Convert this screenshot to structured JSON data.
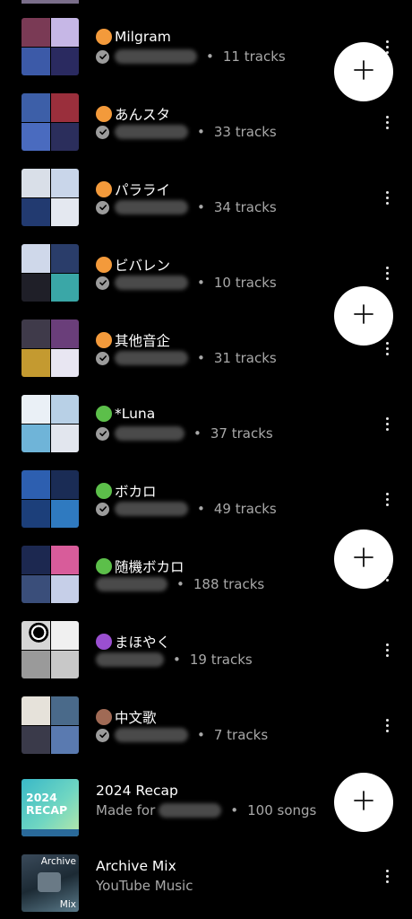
{
  "playlists": [
    {
      "title": "Milgram",
      "dot_color": "#f39a3b",
      "verified": true,
      "redact_w": 92,
      "count": "11 tracks",
      "thumb": [
        "#7a3a55",
        "#c6b7e6",
        "#3c5aa8",
        "#2a2a60"
      ]
    },
    {
      "title": "あんスタ",
      "dot_color": "#f39a3b",
      "verified": true,
      "redact_w": 82,
      "count": "33 tracks",
      "thumb": [
        "#3d5fa8",
        "#9a2f3c",
        "#4a6bbf",
        "#2b2e5c"
      ]
    },
    {
      "title": "パラライ",
      "dot_color": "#f39a3b",
      "verified": true,
      "redact_w": 82,
      "count": "34 tracks",
      "thumb": [
        "#d9dfe8",
        "#c9d6ea",
        "#223a70",
        "#e4e8f0"
      ]
    },
    {
      "title": "ビバレン",
      "dot_color": "#f39a3b",
      "verified": true,
      "redact_w": 82,
      "count": "10 tracks",
      "thumb": [
        "#cfd8ea",
        "#2a3d6a",
        "#1f1f28",
        "#3aa7a7"
      ]
    },
    {
      "title": "其他音企",
      "dot_color": "#f39a3b",
      "verified": true,
      "redact_w": 82,
      "count": "31 tracks",
      "thumb": [
        "#3f3a4a",
        "#6a3e7a",
        "#c49a30",
        "#e8e6f2"
      ]
    },
    {
      "title": "*Luna",
      "dot_color": "#5cbf4a",
      "verified": true,
      "redact_w": 78,
      "count": "37 tracks",
      "thumb": [
        "#eaf0f6",
        "#b8d0e6",
        "#6fb4d8",
        "#e2e6ee"
      ]
    },
    {
      "title": "ボカロ",
      "dot_color": "#5cbf4a",
      "verified": true,
      "redact_w": 82,
      "count": "49 tracks",
      "thumb": [
        "#2d5fb0",
        "#1a2c55",
        "#1c3f7a",
        "#2f7ac0"
      ]
    },
    {
      "title": "随機ボカロ",
      "dot_color": "#5cbf4a",
      "verified": false,
      "redact_w": 80,
      "count": "188 tracks",
      "thumb": [
        "#1c2850",
        "#d85c9a",
        "#3a4e7a",
        "#c6cfe8"
      ]
    },
    {
      "title": "まほやく",
      "dot_color": "#9a4fd0",
      "verified": false,
      "redact_w": 76,
      "count": "19 tracks",
      "thumb": [
        "#d6d6d6",
        "#f0f0f0",
        "#9a9a9a",
        "#c8c8c8"
      ]
    },
    {
      "title": "中文歌",
      "dot_color": "#a06a55",
      "verified": true,
      "redact_w": 82,
      "count": "7 tracks",
      "thumb": [
        "#e6e2da",
        "#4a6a8a",
        "#3a3a4a",
        "#5a7ab0"
      ]
    },
    {
      "title": "2024 Recap",
      "dot_color": "",
      "verified": false,
      "made_for": "Made for",
      "redact_w": 70,
      "count": "100 songs",
      "recap_text": "2024\nRECAP"
    },
    {
      "title": "Archive Mix",
      "dot_color": "",
      "verified": false,
      "subtitle": "YouTube Music",
      "archive_top": "Archive",
      "archive_bottom": "Mix"
    }
  ],
  "fab_icon": "plus-icon",
  "menu_icon": "more-vert-icon"
}
